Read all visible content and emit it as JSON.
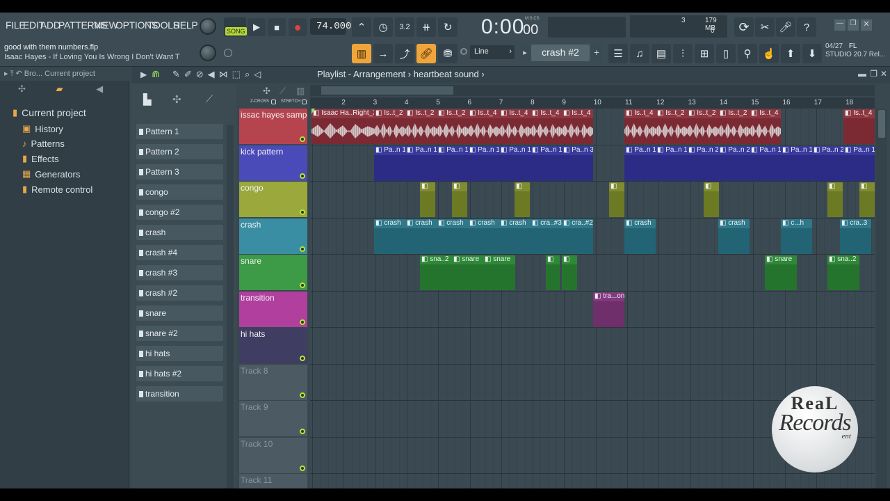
{
  "menu": [
    "FILE",
    "EDIT",
    "ADD",
    "PATTERNS",
    "VIEW",
    "OPTIONS",
    "TOOLS",
    "HELP"
  ],
  "transport": {
    "song_label": "SONG",
    "tempo": "74.000",
    "time": "0:00",
    "time_small": "00",
    "time_unit": "M:S:CS",
    "numerator": "3.2"
  },
  "cpu": {
    "mem": "179 MB",
    "voices": "3",
    "zero": "0"
  },
  "hint": {
    "line1": "good with them numbers.flp",
    "line2": "Isaac Hayes - If Loving You Is Wrong I Don't Want T"
  },
  "toolbar2": {
    "snap": "Line",
    "pattern": "crash #2"
  },
  "studio": {
    "date": "04/27",
    "brand": "FL",
    "version": "STUDIO 20.7 Rel..."
  },
  "browser": {
    "header": "Bro... Current project",
    "root": "Current project",
    "items": [
      {
        "label": "History",
        "icon": "history-icon"
      },
      {
        "label": "Patterns",
        "icon": "note-icon"
      },
      {
        "label": "Effects",
        "icon": "plug-icon"
      },
      {
        "label": "Generators",
        "icon": "grid-icon"
      },
      {
        "label": "Remote control",
        "icon": "plug-icon"
      }
    ]
  },
  "channels": [
    "Pattern 1",
    "Pattern 2",
    "Pattern 3",
    "congo",
    "congo #2",
    "crash",
    "crash #4",
    "crash #3",
    "crash #2",
    "snare",
    "snare #2",
    "hi hats",
    "hi hats #2",
    "transition"
  ],
  "playlist": {
    "title": "Playlist - Arrangement",
    "subtitle": "heartbeat sound",
    "zcross": "Z-CROSS",
    "stretch": "STRETCH"
  },
  "ruler": [
    "2",
    "3",
    "4",
    "5",
    "6",
    "7",
    "8",
    "9",
    "10",
    "11",
    "12",
    "13",
    "14",
    "15",
    "16",
    "17",
    "18"
  ],
  "tracks": [
    {
      "name": "issac hayes sample",
      "color": "#b6444f"
    },
    {
      "name": "kick pattern",
      "color": "#4a4ab8"
    },
    {
      "name": "congo",
      "color": "#9aa83c"
    },
    {
      "name": "crash",
      "color": "#3a8ea3"
    },
    {
      "name": "snare",
      "color": "#3d9a46"
    },
    {
      "name": "transition",
      "color": "#b03f9e"
    },
    {
      "name": "hi hats",
      "color": "#3f3d62"
    },
    {
      "name": "Track 8",
      "color": "#4b5a63"
    },
    {
      "name": "Track 9",
      "color": "#4b5a63"
    },
    {
      "name": "Track 10",
      "color": "#4b5a63"
    },
    {
      "name": "Track 11",
      "color": "#4b5a63"
    }
  ],
  "clips": {
    "issac": [
      "Isaac Ha..Right_3",
      "Is..t_2",
      "Is..t_2",
      "Is..t_2",
      "Is..t_4",
      "Is..t_4",
      "Is..t_4",
      "Is..t_4",
      "Is..t_4",
      "Is..t_2",
      "Is..t_2",
      "Is..t_2",
      "Is..t_4"
    ],
    "kick": [
      "Pa..n 1",
      "Pa..n 1",
      "Pa..n 1",
      "Pa..n 1",
      "Pa..n 1",
      "Pa..n 1",
      "Pa..n 3",
      "Pa..n 1",
      "Pa..n 1",
      "Pa..n 2",
      "Pa..n 2",
      "Pa..n 1",
      "Pa..n 1",
      "Pa..n 2",
      "Pa..n 1"
    ],
    "crash": [
      "crash",
      "crash",
      "crash",
      "crash",
      "crash",
      "cra..#3",
      "cra..#2",
      "crash",
      "crash",
      "c...h",
      "cra..3"
    ],
    "snare": [
      "sna..2",
      "snare",
      "snare",
      "snare",
      "sna..2"
    ],
    "transition": "tra...on"
  },
  "watermark": {
    "line1": "ReaL",
    "line2": "Records",
    "line3": "ent"
  },
  "colors": {
    "accent": "#f0a53b",
    "song": "#b6d838"
  }
}
